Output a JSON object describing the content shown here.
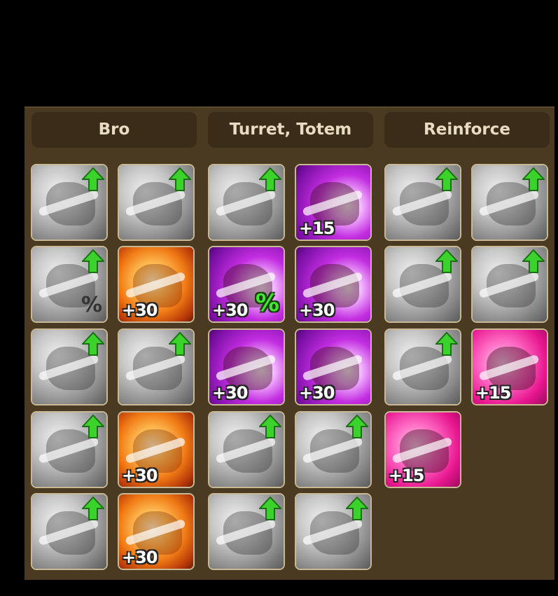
{
  "tabs": [
    {
      "label": "Bro"
    },
    {
      "label": "Turret, Totem"
    },
    {
      "label": "Reinforce"
    }
  ],
  "sections": {
    "bro": [
      [
        {
          "style": "gray",
          "upgrade": true,
          "icon": "dragon-slash-icon"
        },
        {
          "style": "gray",
          "upgrade": true,
          "icon": "dino-slash-icon"
        }
      ],
      [
        {
          "style": "gray",
          "upgrade": true,
          "icon": "fist-percent-icon",
          "extra": "%"
        },
        {
          "style": "fire",
          "upgrade": false,
          "icon": "knight-fire-icon",
          "bonus": "+30"
        }
      ],
      [
        {
          "style": "gray",
          "upgrade": true,
          "icon": "fist-punch-icon"
        },
        {
          "style": "gray",
          "upgrade": true,
          "icon": "knight-burst-icon"
        }
      ],
      [
        {
          "style": "gray",
          "upgrade": true,
          "icon": "warrior-strike-icon"
        },
        {
          "style": "fire",
          "upgrade": false,
          "icon": "fire-explosion-icon",
          "bonus": "+30"
        }
      ],
      [
        {
          "style": "gray",
          "upgrade": true,
          "icon": "cannon-balls-icon"
        },
        {
          "style": "fire",
          "upgrade": false,
          "icon": "fire-beam-icon",
          "bonus": "+30"
        }
      ]
    ],
    "turret": [
      [
        {
          "style": "gray",
          "upgrade": true,
          "icon": "dragon-slash-icon"
        },
        {
          "style": "purple",
          "upgrade": false,
          "icon": "dino-slash-purple-icon",
          "bonus": "+15"
        }
      ],
      [
        {
          "style": "purple",
          "upgrade": false,
          "icon": "turret-burst-percent-icon",
          "bonus": "+30",
          "extra": "%"
        },
        {
          "style": "purple",
          "upgrade": false,
          "icon": "turret-burst-icon",
          "bonus": "+30"
        }
      ],
      [
        {
          "style": "purple",
          "upgrade": false,
          "icon": "turret-shadow-icon",
          "bonus": "+30"
        },
        {
          "style": "purple",
          "upgrade": false,
          "icon": "target-shots-icon",
          "bonus": "+30"
        }
      ],
      [
        {
          "style": "gray",
          "upgrade": true,
          "icon": "dragon-slash-icon"
        },
        {
          "style": "gray",
          "upgrade": true,
          "icon": "dino-slash-icon"
        }
      ],
      [
        {
          "style": "gray",
          "upgrade": true,
          "icon": "totem-lightning-icon"
        },
        {
          "style": "gray",
          "upgrade": true,
          "icon": "lightning-slash-icon"
        }
      ]
    ],
    "reinforce": [
      [
        {
          "style": "gray",
          "upgrade": true,
          "icon": "hero-hourglass-icon"
        },
        {
          "style": "gray",
          "upgrade": true,
          "icon": "raised-fist-icon"
        }
      ],
      [
        {
          "style": "gray",
          "upgrade": true,
          "icon": "wings-icon"
        },
        {
          "style": "gray",
          "upgrade": true,
          "icon": "slime-hourglass-icon"
        }
      ],
      [
        {
          "style": "gray",
          "upgrade": true,
          "icon": "slime-retreat-icon"
        },
        {
          "style": "pink",
          "upgrade": false,
          "icon": "dino-retreat-icon",
          "bonus": "+15"
        }
      ],
      [
        {
          "style": "pink",
          "upgrade": false,
          "icon": "dino-crying-icon",
          "bonus": "+15"
        }
      ]
    ]
  },
  "colors": {
    "background": "#000000",
    "panel": "#4a3a22",
    "header": "#3a2c18",
    "header_text": "#e8dcc5",
    "upgrade_arrow": "#3bd32b",
    "tile_border": "#c9b894"
  }
}
